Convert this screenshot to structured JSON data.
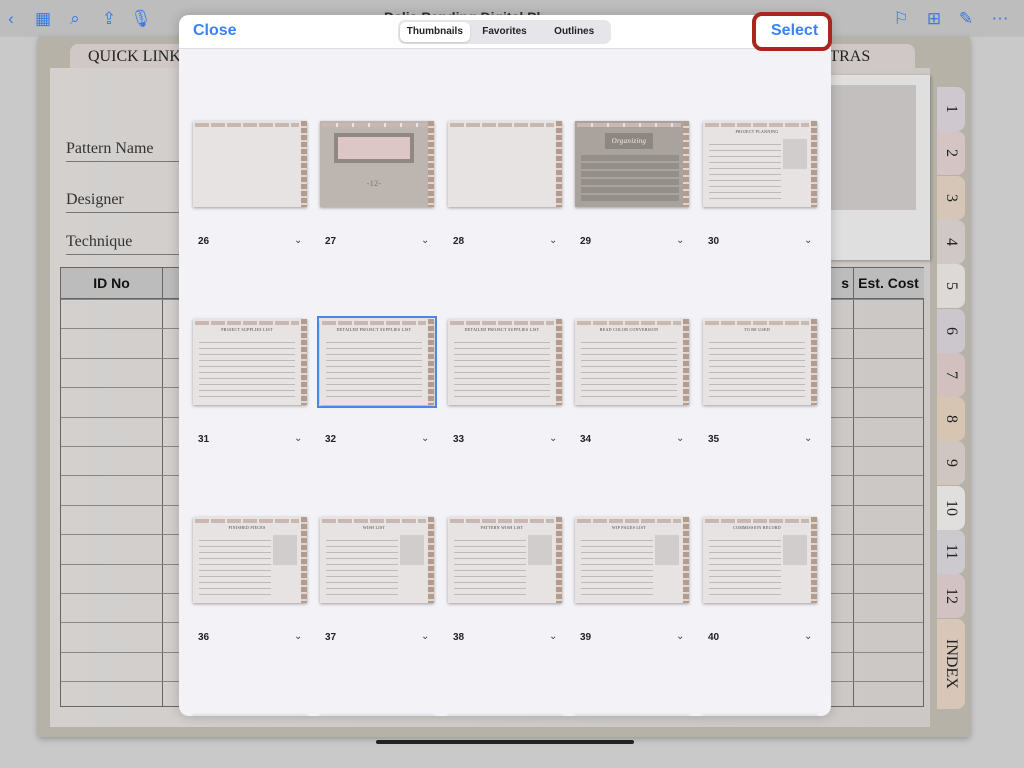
{
  "toolbar": {
    "title": "Dalia Pending Digital Pl",
    "left_icons": [
      "chevron-left-icon",
      "grid-icon",
      "search-icon",
      "share-icon",
      "microphone-icon"
    ],
    "right_icons": [
      "bookmark-icon",
      "add-page-icon",
      "pencil-circle-icon",
      "more-icon"
    ]
  },
  "background": {
    "quick_links": "QUICK LINKS",
    "extras": "EXTRAS",
    "fields": [
      "Pattern Name",
      "Designer",
      "Technique"
    ],
    "table_headers": [
      "ID No",
      "Est. Cost"
    ],
    "partial_header": "s",
    "side_tabs": [
      "1",
      "2",
      "3",
      "4",
      "5",
      "6",
      "7",
      "8",
      "9",
      "10",
      "11",
      "12",
      "INDEX"
    ],
    "tab_colors": [
      "#cfc9cf",
      "#d4c4c4",
      "#d6c6b8",
      "#d0c8c6",
      "#dcd9d6",
      "#cbc7cc",
      "#d2c0bf",
      "#d6c5b3",
      "#cfc5c1",
      "#e0dfdd",
      "#ccc9cf",
      "#d3c2c3",
      "#d8c7b8"
    ]
  },
  "modal": {
    "close": "Close",
    "select": "Select",
    "tabs": [
      "Thumbnails",
      "Favorites",
      "Outlines"
    ],
    "active_tab": "Thumbnails",
    "highlight_color": "#a8261c",
    "accent": "#3b82f6",
    "pages": [
      {
        "n": "26",
        "type": "blank",
        "title": ""
      },
      {
        "n": "27",
        "type": "cover",
        "title": "-12-"
      },
      {
        "n": "28",
        "type": "blank",
        "title": ""
      },
      {
        "n": "29",
        "type": "organizing",
        "title": "Organizing"
      },
      {
        "n": "30",
        "type": "form",
        "title": "PROJECT PLANNING"
      },
      {
        "n": "31",
        "type": "table",
        "title": "PROJECT SUPPLIES LIST"
      },
      {
        "n": "32",
        "type": "table",
        "title": "DETAILED PROJECT SUPPLIES LIST",
        "selected": true
      },
      {
        "n": "33",
        "type": "table",
        "title": "DETAILED PROJECT SUPPLIES LIST"
      },
      {
        "n": "34",
        "type": "table",
        "title": "BEAD COLOR CONVERSION"
      },
      {
        "n": "35",
        "type": "table",
        "title": "TO BE USED"
      },
      {
        "n": "36",
        "type": "form",
        "title": "FINISHED PIECES"
      },
      {
        "n": "37",
        "type": "form",
        "title": "WISH LIST"
      },
      {
        "n": "38",
        "type": "form",
        "title": "PATTERN WISH LIST"
      },
      {
        "n": "39",
        "type": "form",
        "title": "WIP PAGES LIST"
      },
      {
        "n": "40",
        "type": "form",
        "title": "COMMISSION RECORD"
      }
    ]
  }
}
